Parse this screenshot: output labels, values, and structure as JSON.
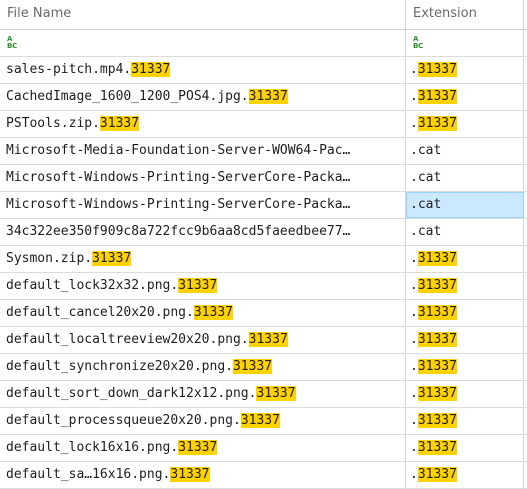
{
  "columns": {
    "name": "File Name",
    "extension": "Extension"
  },
  "filter_icon": "abc-filter-icon",
  "highlight_color": "#ffd200",
  "selection_color": "#cce8ff",
  "rows": [
    {
      "name": "sales-pitch.mp4.",
      "name_hl": "31337",
      "ext": ".",
      "ext_hl": "31337"
    },
    {
      "name": "CachedImage_1600_1200_POS4.jpg.",
      "name_hl": "31337",
      "ext": ".",
      "ext_hl": "31337"
    },
    {
      "name": "PSTools.zip.",
      "name_hl": "31337",
      "ext": ".",
      "ext_hl": "31337"
    },
    {
      "name": "Microsoft-Media-Foundation-Server-WOW64-Pac…",
      "name_hl": "",
      "ext": ".cat",
      "ext_hl": ""
    },
    {
      "name": "Microsoft-Windows-Printing-ServerCore-Packa…",
      "name_hl": "",
      "ext": ".cat",
      "ext_hl": ""
    },
    {
      "name": "Microsoft-Windows-Printing-ServerCore-Packa…",
      "name_hl": "",
      "ext": ".cat",
      "ext_hl": "",
      "selected": true
    },
    {
      "name": "34c322ee350f909c8a722fcc9b6aa8cd5faeedbee77…",
      "name_hl": "",
      "ext": ".cat",
      "ext_hl": ""
    },
    {
      "name": "Sysmon.zip.",
      "name_hl": "31337",
      "ext": ".",
      "ext_hl": "31337"
    },
    {
      "name": "default_lock32x32.png.",
      "name_hl": "31337",
      "ext": ".",
      "ext_hl": "31337"
    },
    {
      "name": "default_cancel20x20.png.",
      "name_hl": "31337",
      "ext": ".",
      "ext_hl": "31337"
    },
    {
      "name": "default_localtreeview20x20.png.",
      "name_hl": "31337",
      "ext": ".",
      "ext_hl": "31337"
    },
    {
      "name": "default_synchronize20x20.png.",
      "name_hl": "31337",
      "ext": ".",
      "ext_hl": "31337"
    },
    {
      "name": "default_sort_down_dark12x12.png.",
      "name_hl": "31337",
      "ext": ".",
      "ext_hl": "31337"
    },
    {
      "name": "default_processqueue20x20.png.",
      "name_hl": "31337",
      "ext": ".",
      "ext_hl": "31337"
    },
    {
      "name": "default_lock16x16.png.",
      "name_hl": "31337",
      "ext": ".",
      "ext_hl": "31337"
    },
    {
      "name": "default_sa…16x16.png.",
      "name_hl": "31337",
      "ext": ".",
      "ext_hl": "31337"
    }
  ]
}
